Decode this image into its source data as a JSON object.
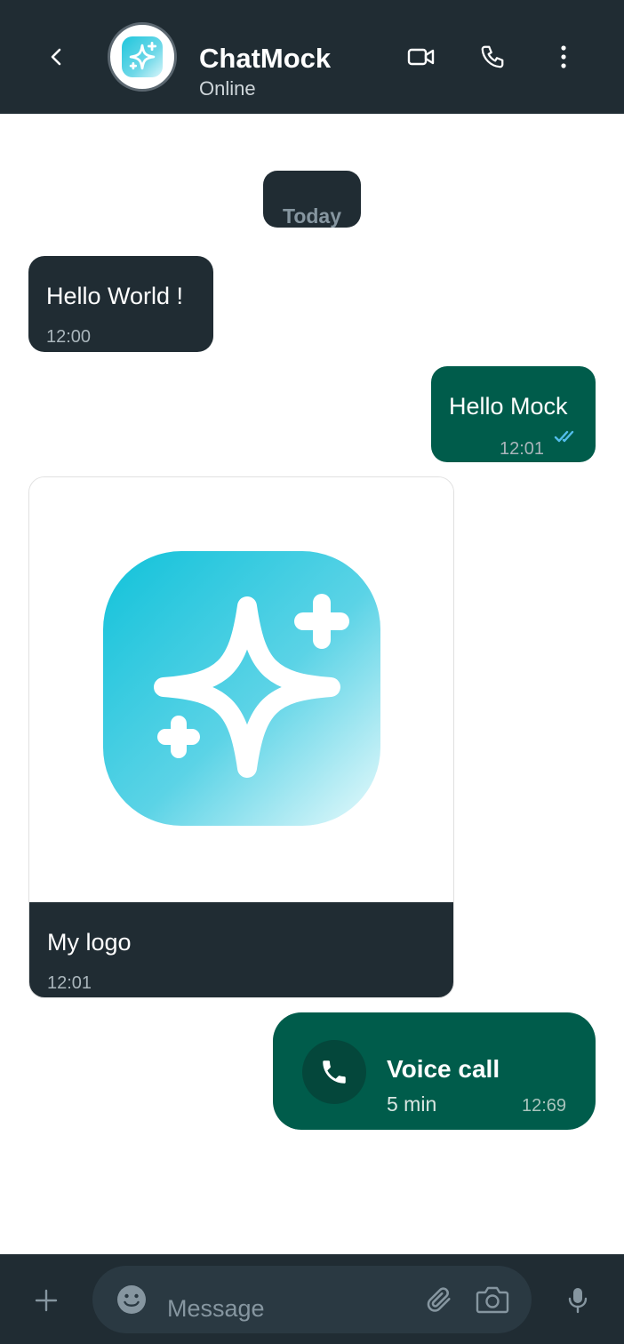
{
  "header": {
    "contact_name": "ChatMock",
    "status": "Online",
    "icons": [
      "back-arrow-icon",
      "video-call-icon",
      "phone-icon",
      "more-vertical-icon"
    ]
  },
  "date_chip": "Today",
  "messages": [
    {
      "direction": "incoming",
      "text": "Hello World !",
      "time": "12:00"
    },
    {
      "direction": "outgoing",
      "text": "Hello Mock",
      "time": "12:01",
      "status": "read"
    },
    {
      "direction": "incoming",
      "type": "image",
      "caption": "My logo",
      "time": "12:01"
    },
    {
      "direction": "outgoing",
      "type": "call",
      "title": "Voice call",
      "duration": "5 min",
      "time": "12:69"
    }
  ],
  "input": {
    "placeholder": "Message",
    "icons": [
      "plus-icon",
      "emoji-icon",
      "attachment-icon",
      "camera-icon",
      "microphone-icon"
    ]
  },
  "colors": {
    "header_bg": "#202c33",
    "incoming_bubble": "#202c33",
    "outgoing_bubble": "#005c4b",
    "read_tick": "#53bdeb",
    "logo_gradient_start": "#12c2da",
    "logo_gradient_end": "#e8fafc"
  }
}
